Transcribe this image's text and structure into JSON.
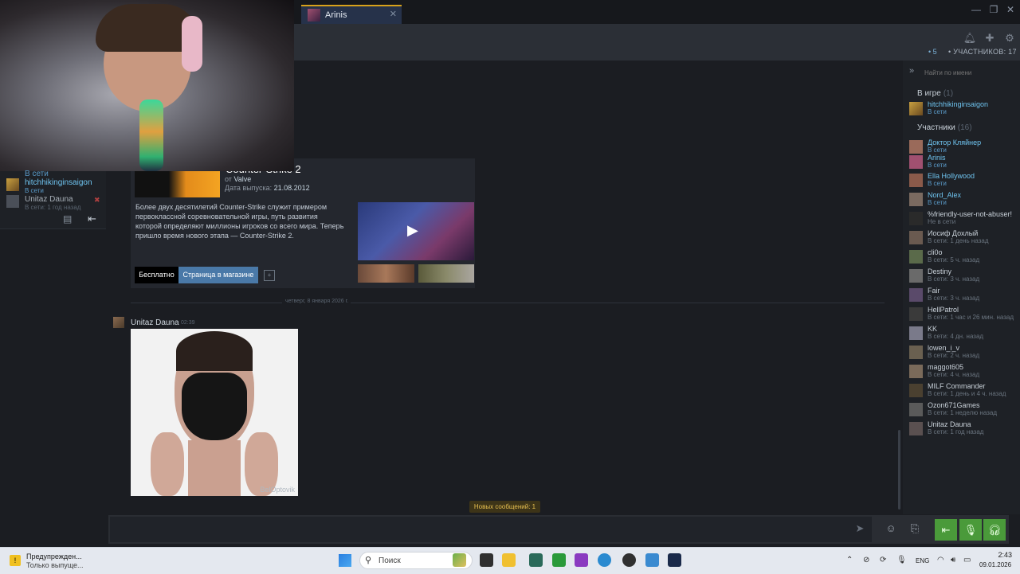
{
  "tab": {
    "label": "Arinis"
  },
  "header": {
    "online_count": "• 5",
    "members_count": "• УЧАСТНИКОВ: 17"
  },
  "left_panel": {
    "members": [
      {
        "name": "",
        "status": "В сети"
      },
      {
        "name": "hitchhikinginsaigon",
        "status": "В сети"
      },
      {
        "name": "Unitaz Dauna",
        "status": "В сети: 1 год назад"
      }
    ]
  },
  "game_embed": {
    "title": "Counter-Strike 2",
    "developer_prefix": "от",
    "developer": "Valve",
    "release_label": "Дата выпуска:",
    "release_date": "21.08.2012",
    "description": "Более двух десятилетий Counter-Strike служит примером первоклассной соревновательной игры, путь развития которой определяют миллионы игроков со всего мира. Теперь пришло время нового этапа — Counter-Strike 2.",
    "price_label": "Бесплатно",
    "store_button": "Страница в магазине"
  },
  "divider": {
    "date": "четверг, 8 января 2026 г."
  },
  "message": {
    "author": "Unitaz Dauna",
    "time": "02:39",
    "watermark": "BelOptovik"
  },
  "new_messages": "Новых сообщений: 1",
  "chat_input": {
    "value": ""
  },
  "member_list": {
    "search_placeholder": "Найти по имени",
    "in_game_label": "В игре",
    "in_game_count": "(1)",
    "in_game": [
      {
        "name": "hitchhikinginsaigon",
        "status": "В сети"
      }
    ],
    "members_label": "Участники",
    "members_count": "(16)",
    "members": [
      {
        "name": "Доктор Кляйнер",
        "status": "В сети",
        "online": true
      },
      {
        "name": "Arinis",
        "status": "В сети",
        "online": true
      },
      {
        "name": "Ella Hollywood",
        "status": "В сети",
        "online": true
      },
      {
        "name": "Nord_Alex",
        "status": "В сети",
        "online": true
      },
      {
        "name": "%friendly-user-not-abuser!",
        "status": "Не в сети",
        "online": false
      },
      {
        "name": "Иосиф Дохлый",
        "status": "В сети: 1 день назад",
        "online": false
      },
      {
        "name": "cli0o",
        "status": "В сети: 5 ч. назад",
        "online": false
      },
      {
        "name": "Destiny",
        "status": "В сети: 3 ч. назад",
        "online": false
      },
      {
        "name": "Fair",
        "status": "В сети: 3 ч. назад",
        "online": false
      },
      {
        "name": "HellPatrol",
        "status": "В сети: 1 час и 26 мин. назад",
        "online": false
      },
      {
        "name": "KK",
        "status": "В сети: 4 дн. назад",
        "online": false
      },
      {
        "name": "lowen_i_v",
        "status": "В сети: 2 ч. назад",
        "online": false
      },
      {
        "name": "maggot605",
        "status": "В сети: 4 ч. назад",
        "online": false
      },
      {
        "name": "MILF Commander",
        "status": "В сети: 1 день и 4 ч. назад",
        "online": false
      },
      {
        "name": "Ozon671Games",
        "status": "В сети: 1 неделю назад",
        "online": false
      },
      {
        "name": "Unitaz Dauna",
        "status": "В сети: 1 год назад",
        "online": false
      }
    ]
  },
  "taskbar": {
    "notification_title": "Предупрежден...",
    "notification_sub": "Только выпуще...",
    "search_placeholder": "Поиск",
    "lang": "ENG",
    "time": "2:43",
    "date": "09.01.2026"
  },
  "icons": [
    "bell-icon",
    "add-friend-icon",
    "settings-icon",
    "collapse-icon",
    "send-icon",
    "emoji-icon",
    "attach-icon",
    "leave-voice-icon",
    "mic-icon",
    "headset-icon",
    "play-icon",
    "search-icon",
    "windows-start-icon"
  ],
  "colors": {
    "accent_tab": "#d8a21a",
    "online_blue": "#6fc4f0",
    "voice_green": "#4a9a3a",
    "store_blue": "#4a79a8"
  }
}
